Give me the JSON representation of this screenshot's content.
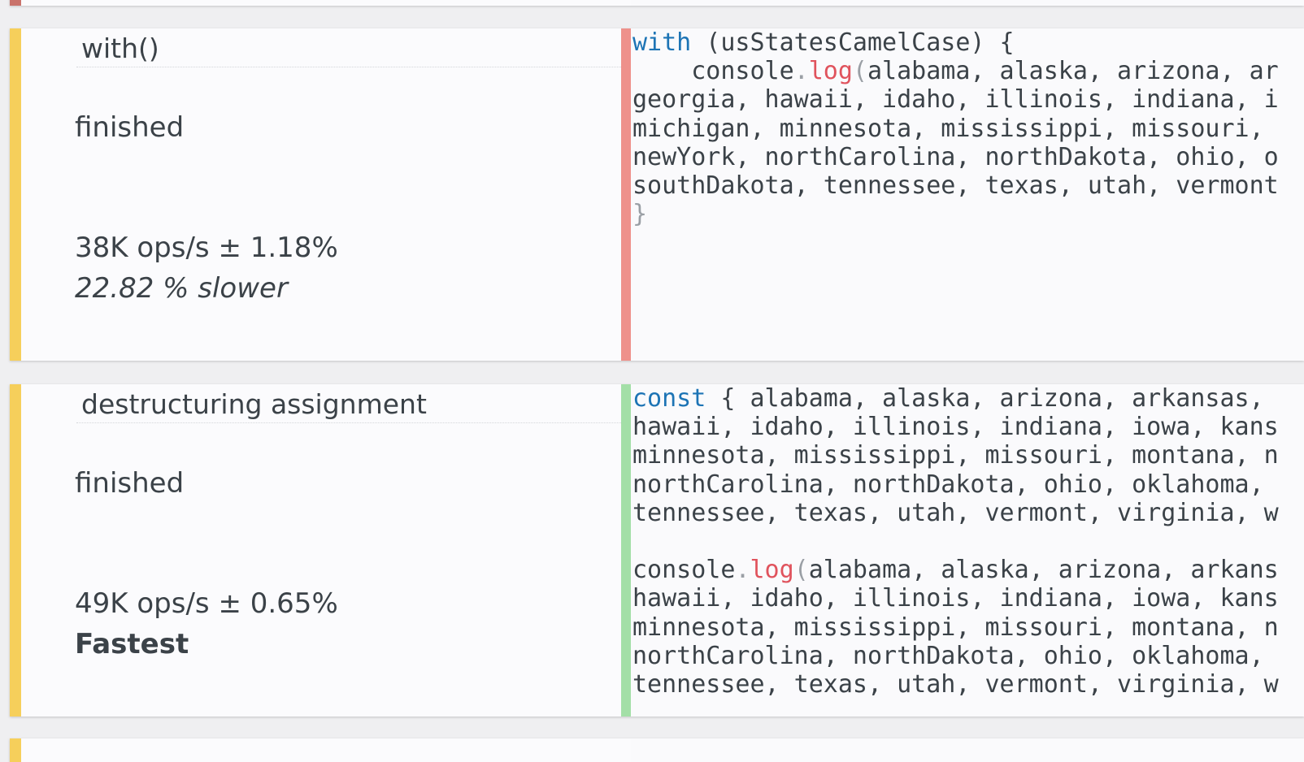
{
  "colors": {
    "card_accent": "#f6cf5b",
    "slower_divider": "#ee918b",
    "fastest_divider": "#a3dfa7",
    "keyword": "#1d74b5",
    "function": "#e0535d",
    "punctuation": "#9a9fa5",
    "text": "#3b4248"
  },
  "tests": [
    {
      "name": "with()",
      "status": "finished",
      "ops": "38K ops/s ± 1.18%",
      "verdict": "22.82 % slower",
      "divider_color": "#ee918b",
      "code": {
        "l1": {
          "kw": "with",
          "rest": " (usStatesCamelCase) {"
        },
        "l2": {
          "indent": "    ",
          "obj": "console",
          "dot": ".",
          "fn": "log",
          "paren": "(",
          "args": "alabama, alaska, arizona, ar"
        },
        "l3": "georgia, hawaii, idaho, illinois, indiana, i",
        "l4": "michigan, minnesota, mississippi, missouri,",
        "l5": "newYork, northCarolina, northDakota, ohio, o",
        "l6": "southDakota, tennessee, texas, utah, vermont",
        "l7": "}"
      }
    },
    {
      "name": "destructuring assignment",
      "status": "finished",
      "ops": "49K ops/s ± 0.65%",
      "verdict": "Fastest",
      "divider_color": "#a3dfa7",
      "code": {
        "l1": {
          "kw": "const",
          "rest": " { alabama, alaska, arizona, arkansas,"
        },
        "l2": "hawaii, idaho, illinois, indiana, iowa, kans",
        "l3": "minnesota, mississippi, missouri, montana, n",
        "l4": "northCarolina, northDakota, ohio, oklahoma,",
        "l5": "tennessee, texas, utah, vermont, virginia, w",
        "l7": {
          "obj": "console",
          "dot": ".",
          "fn": "log",
          "paren": "(",
          "args": "alabama, alaska, arizona, arkans"
        },
        "l8": "hawaii, idaho, illinois, indiana, iowa, kans",
        "l9": "minnesota, mississippi, missouri, montana, n",
        "l10": "northCarolina, northDakota, ohio, oklahoma,",
        "l11": "tennessee, texas, utah, vermont, virginia, w"
      }
    }
  ]
}
